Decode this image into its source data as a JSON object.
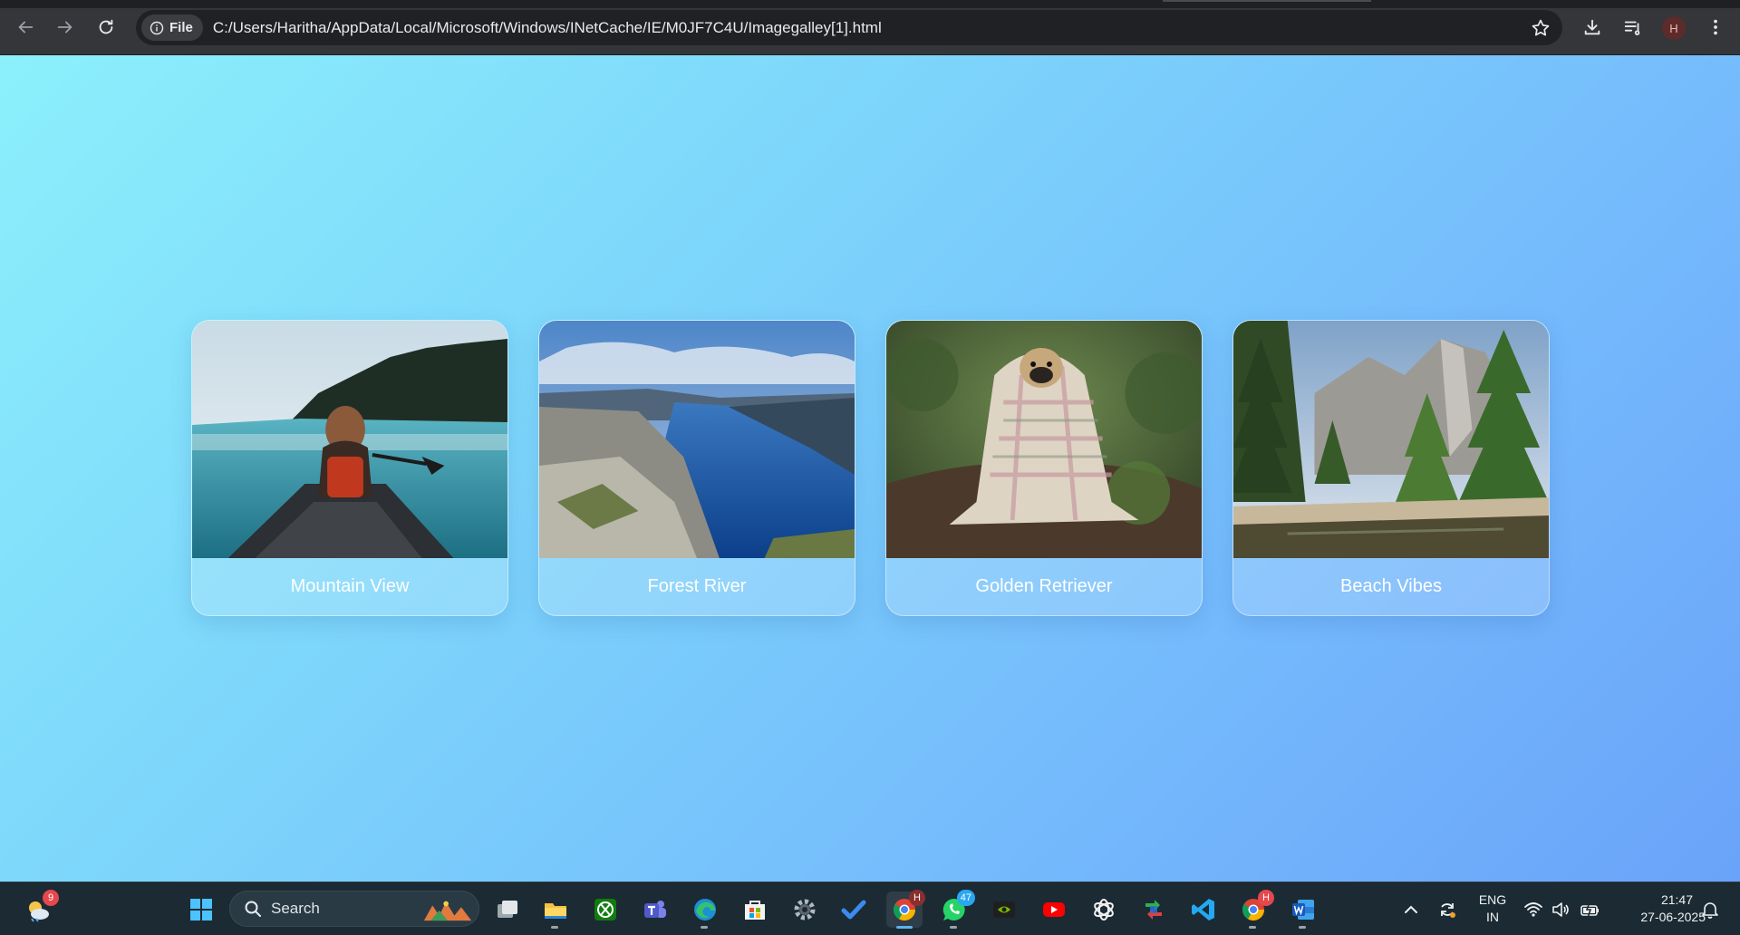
{
  "browser": {
    "chip_label": "File",
    "url": "C:/Users/Haritha/AppData/Local/Microsoft/Windows/INetCache/IE/M0JF7C4U/Imagegalley[1].html",
    "profile_initial": "H"
  },
  "gallery": {
    "cards": [
      {
        "caption": "Mountain View"
      },
      {
        "caption": "Forest River"
      },
      {
        "caption": "Golden Retriever"
      },
      {
        "caption": "Beach Vibes"
      }
    ]
  },
  "taskbar": {
    "weather_badge": "9",
    "search_label": "Search",
    "whatsapp_badge": "47",
    "chrome_badge": "H",
    "chrome2_badge": "H",
    "language": "ENG",
    "region": "IN",
    "time": "21:47",
    "date": "27-06-2025"
  },
  "colors": {
    "page_gradient_start": "#8cf0fb",
    "page_gradient_end": "#6aa3f9",
    "taskbar": "#1c2a33",
    "browser_toolbar": "#35363a"
  }
}
